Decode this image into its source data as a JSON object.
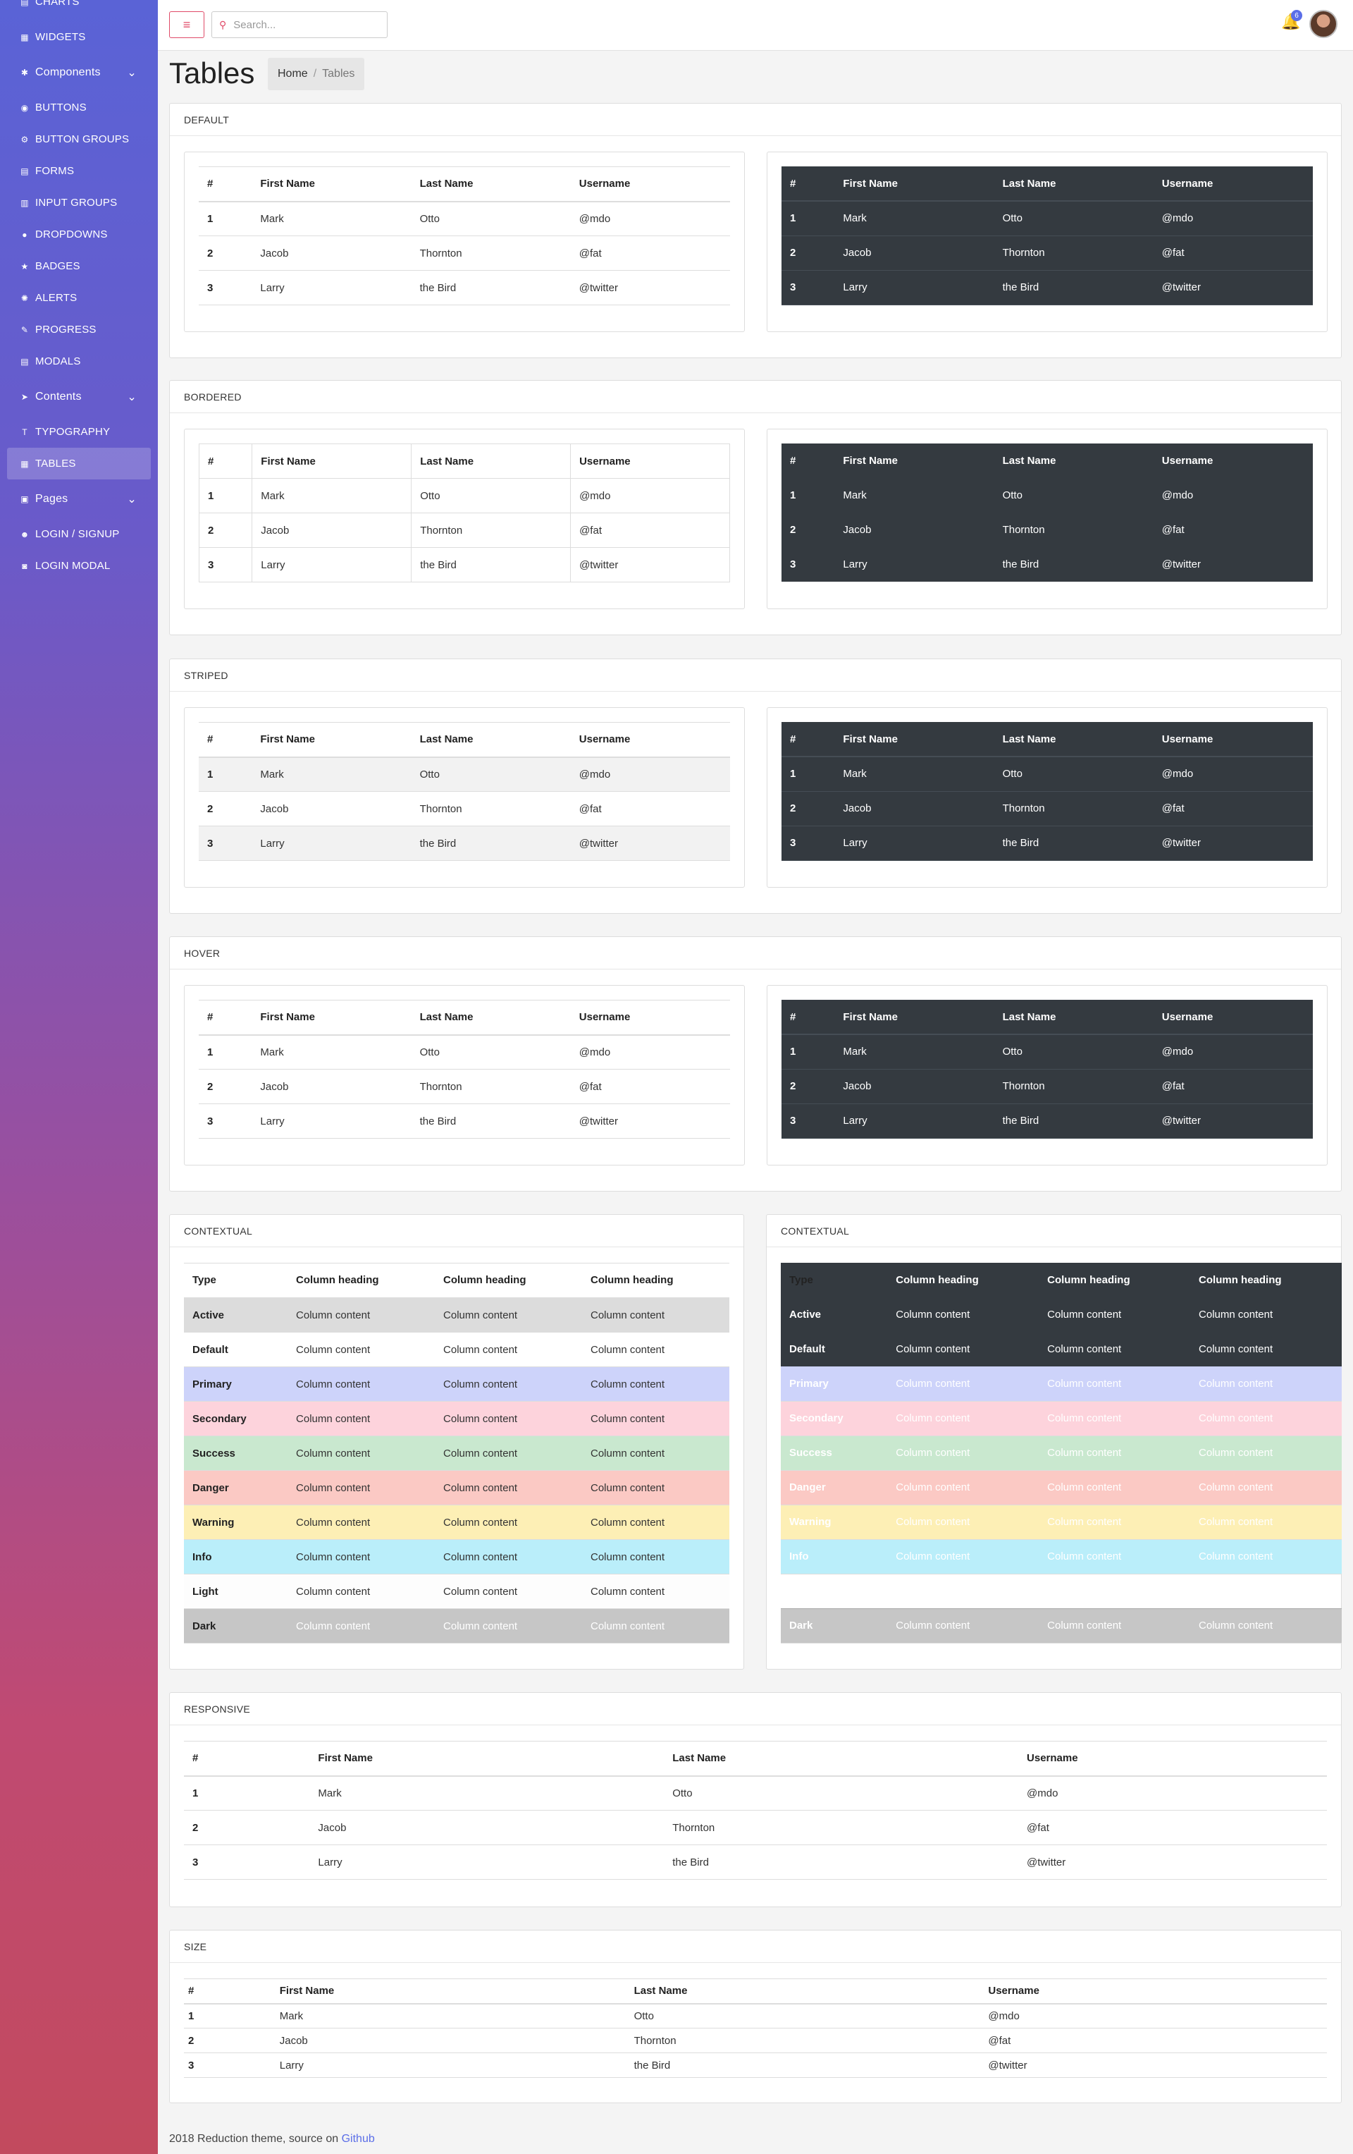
{
  "sidebar": {
    "items": [
      {
        "label": "CHARTS",
        "icon": "chart-icon",
        "chev": ""
      },
      {
        "label": "WIDGETS",
        "icon": "widgets-icon",
        "chev": ""
      },
      {
        "label": "Components",
        "icon": "components-icon",
        "chev": "⌄"
      },
      {
        "label": "BUTTONS",
        "icon": "buttons-icon",
        "chev": ""
      },
      {
        "label": "BUTTON GROUPS",
        "icon": "button-groups-icon",
        "chev": ""
      },
      {
        "label": "FORMS",
        "icon": "forms-icon",
        "chev": ""
      },
      {
        "label": "INPUT GROUPS",
        "icon": "input-groups-icon",
        "chev": ""
      },
      {
        "label": "DROPDOWNS",
        "icon": "dropdowns-icon",
        "chev": ""
      },
      {
        "label": "BADGES",
        "icon": "badges-icon",
        "chev": ""
      },
      {
        "label": "ALERTS",
        "icon": "alerts-icon",
        "chev": ""
      },
      {
        "label": "PROGRESS",
        "icon": "progress-icon",
        "chev": ""
      },
      {
        "label": "MODALS",
        "icon": "modals-icon",
        "chev": ""
      },
      {
        "label": "Contents",
        "icon": "contents-icon",
        "chev": "⌄"
      },
      {
        "label": "TYPOGRAPHY",
        "icon": "typography-icon",
        "chev": ""
      },
      {
        "label": "TABLES",
        "icon": "tables-icon",
        "chev": ""
      },
      {
        "label": "Pages",
        "icon": "pages-icon",
        "chev": "⌄"
      },
      {
        "label": "LOGIN / SIGNUP",
        "icon": "login-icon",
        "chev": ""
      },
      {
        "label": "LOGIN MODAL",
        "icon": "login-modal-icon",
        "chev": ""
      }
    ]
  },
  "topbar": {
    "search_placeholder": "Search...",
    "bell_count": "6"
  },
  "page": {
    "title": "Tables"
  },
  "breadcrumb": {
    "home": "Home",
    "sep": "/",
    "current": "Tables"
  },
  "sections": {
    "default": "DEFAULT",
    "bordered": "BORDERED",
    "striped": "STRIPED",
    "hover": "HOVER",
    "contextual": "CONTEXTUAL",
    "responsive": "RESPONSIVE",
    "size": "SIZE"
  },
  "basic_table": {
    "headers": [
      "#",
      "First Name",
      "Last Name",
      "Username"
    ],
    "rows": [
      [
        "1",
        "Mark",
        "Otto",
        "@mdo"
      ],
      [
        "2",
        "Jacob",
        "Thornton",
        "@fat"
      ],
      [
        "3",
        "Larry",
        "the Bird",
        "@twitter"
      ]
    ]
  },
  "contextual_table": {
    "headers": [
      "Type",
      "Column heading",
      "Column heading",
      "Column heading"
    ],
    "cell": "Column content",
    "types": [
      "Active",
      "Default",
      "Primary",
      "Secondary",
      "Success",
      "Danger",
      "Warning",
      "Info",
      "Light",
      "Dark"
    ]
  },
  "footer": {
    "text": "2018 Reduction theme, source on ",
    "link": "Github"
  }
}
